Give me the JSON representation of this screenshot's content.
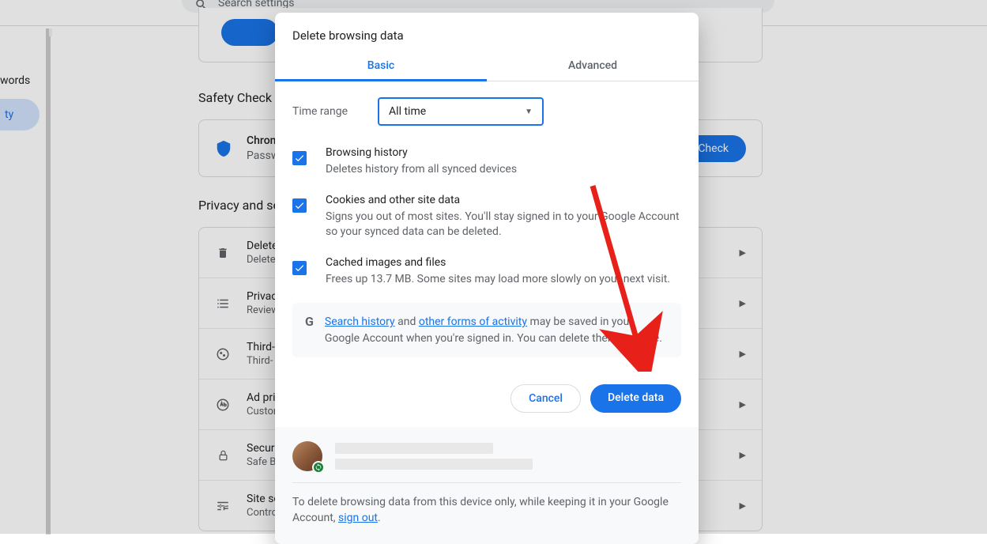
{
  "search_placeholder": "Search settings",
  "sidebar": {
    "item_autofill": "words",
    "item_privacy": "ty"
  },
  "sections": {
    "safety_check_title": "Safety Check",
    "safety_card_title": "Chrom",
    "safety_card_sub": "Passwo",
    "safety_check_btn": "y Check",
    "privacy_title": "Privacy and se",
    "rows": {
      "delete": {
        "title": "Delete",
        "sub": "Delete"
      },
      "guide": {
        "title": "Privacy",
        "sub": "Review"
      },
      "cookies": {
        "title": "Third-",
        "sub": "Third-"
      },
      "ad": {
        "title": "Ad priv",
        "sub": "Custom"
      },
      "security": {
        "title": "Securit",
        "sub": "Safe B"
      },
      "site": {
        "title": "Site settings",
        "sub": "Controls what information sites can use and show (location, camera, pop-ups, and more)"
      }
    }
  },
  "dialog": {
    "title": "Delete browsing data",
    "tab_basic": "Basic",
    "tab_advanced": "Advanced",
    "time_range_label": "Time range",
    "time_range_value": "All time",
    "options": {
      "history": {
        "title": "Browsing history",
        "desc": "Deletes history from all synced devices"
      },
      "cookies": {
        "title": "Cookies and other site data",
        "desc": "Signs you out of most sites. You'll stay signed in to your Google Account so your synced data can be deleted."
      },
      "cache": {
        "title": "Cached images and files",
        "desc": "Frees up 13.7 MB. Some sites may load more slowly on your next visit."
      }
    },
    "info": {
      "link1": "Search history",
      "mid": " and ",
      "link2": "other forms of activity",
      "rest": " may be saved in your Google Account when you're signed in. You can delete them anytime."
    },
    "cancel": "Cancel",
    "confirm": "Delete data",
    "footer_text": "To delete browsing data from this device only, while keeping it in your Google Account, ",
    "signout": "sign out",
    "period": "."
  }
}
